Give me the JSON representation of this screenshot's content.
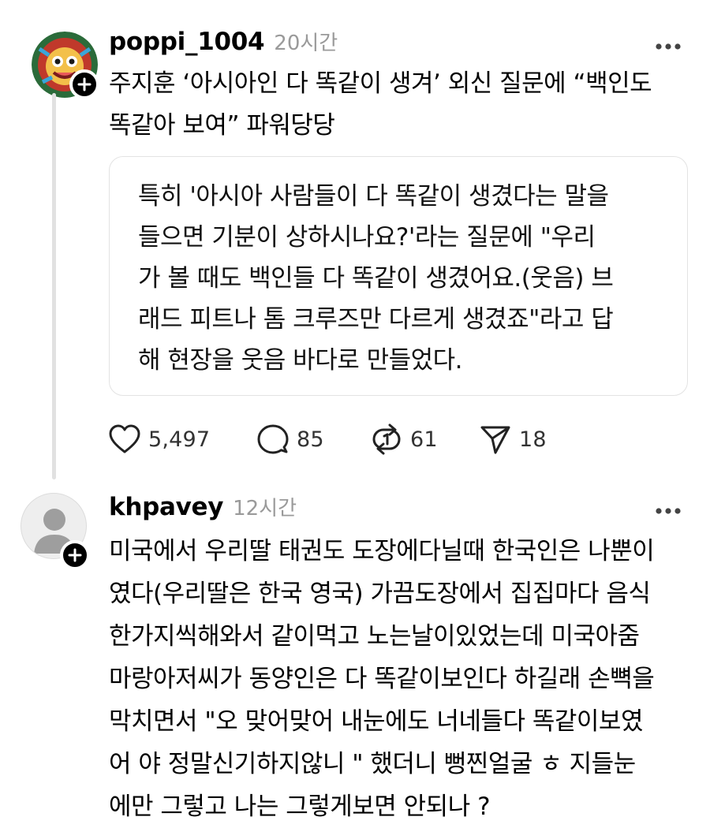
{
  "posts": [
    {
      "username": "poppi_1004",
      "time": "20시간",
      "text": "주지훈 ‘아시아인 다 똑같이 생겨’ 외신 질문에 “백인도\n똑같아 보여” 파워당당",
      "quote": "특히 '아시아 사람들이 다 똑같이 생겼다는 말을\n들으면 기분이 상하시나요?'라는 질문에 \"우리\n가 볼 때도 백인들 다 똑같이 생겼어요.(웃음) 브\n래드 피트나 톰 크루즈만 다르게 생겼죠\"라고 답\n해 현장을 웃음 바다로 만들었다.",
      "actions": {
        "likes": "5,497",
        "replies": "85",
        "reposts": "61",
        "shares": "18"
      },
      "icons": [
        "colorful-avatar-icon",
        "plus-icon",
        "more-icon",
        "heart-icon",
        "comment-icon",
        "repost-icon",
        "send-icon"
      ]
    },
    {
      "username": "khpavey",
      "time": "12시간",
      "text": "미국에서 우리딸 태권도 도장에다닐때 한국인은 나뿐이\n였다(우리딸은 한국 영국) 가끔도장에서 집집마다 음식\n한가지씩해와서 같이먹고 노는날이있었는데 미국아줌\n마랑아저씨가 동양인은 다 똑같이보인다 하길래 손뼉을\n막치면서 \"오 맞어맞어  내눈에도 너네들다 똑같이보였\n어 야 정말신기하지않니 \" 했더니 뻥찐얼굴  ㅎ 지들눈\n에만 그렇고 나는 그렇게보면 안되나 ?",
      "icons": [
        "default-avatar-icon",
        "plus-icon",
        "more-icon"
      ]
    }
  ],
  "colors": {
    "text": "#000000",
    "muted": "#9a9a9a",
    "border": "#e3e3e3",
    "thread_line": "#e1e1e1"
  }
}
